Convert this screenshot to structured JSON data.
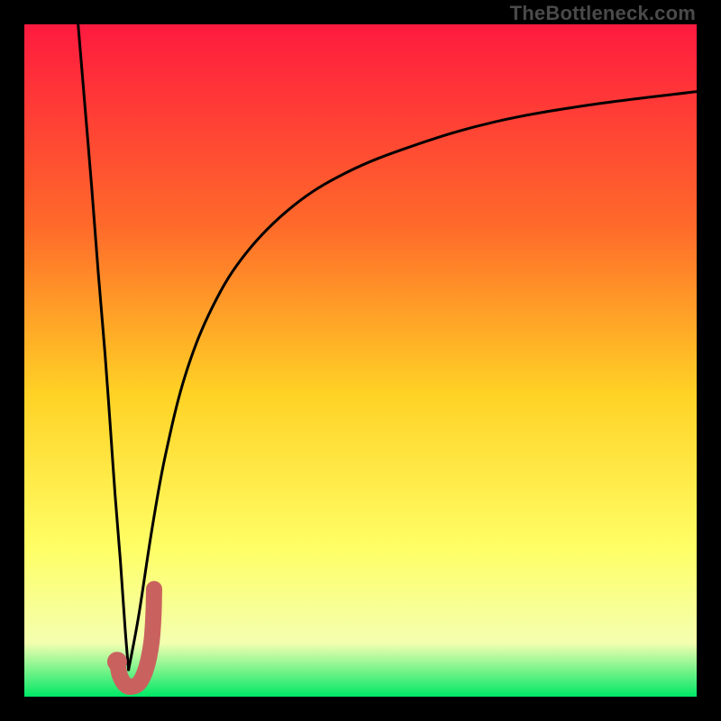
{
  "watermark": "TheBottleneck.com",
  "colors": {
    "gradient_top": "#ff1a3f",
    "gradient_mid_top": "#ff6a2a",
    "gradient_mid": "#ffd225",
    "gradient_mid_low": "#ffff66",
    "gradient_low": "#f4ffb0",
    "gradient_bottom": "#00e866",
    "curve": "#000000",
    "marker": "#c9625f",
    "frame": "#000000"
  },
  "chart_data": {
    "type": "line",
    "title": "",
    "xlabel": "",
    "ylabel": "",
    "xlim": [
      0,
      100
    ],
    "ylim": [
      0,
      100
    ],
    "series": [
      {
        "name": "falling-branch",
        "x": [
          8,
          9,
          10,
          11,
          12,
          12.8,
          13.5,
          14.3,
          15,
          15.5
        ],
        "values": [
          100,
          88,
          76,
          63,
          51,
          40,
          30,
          20,
          10,
          4
        ]
      },
      {
        "name": "rising-branch",
        "x": [
          15.5,
          17,
          19,
          21,
          24,
          28,
          33,
          40,
          48,
          58,
          70,
          84,
          100
        ],
        "values": [
          4,
          12,
          25,
          36,
          48,
          58,
          66,
          73,
          78,
          82,
          85.5,
          88,
          90
        ]
      },
      {
        "name": "marker-hook",
        "x": [
          13.8,
          14.2,
          15,
          16,
          17.2,
          18.2,
          18.9,
          19.2,
          19.3
        ],
        "values": [
          5.2,
          3.2,
          1.8,
          1.5,
          2.2,
          4.5,
          8,
          12,
          16
        ]
      }
    ],
    "marker_point": {
      "x": 13.8,
      "y": 5.2
    },
    "annotations": []
  }
}
